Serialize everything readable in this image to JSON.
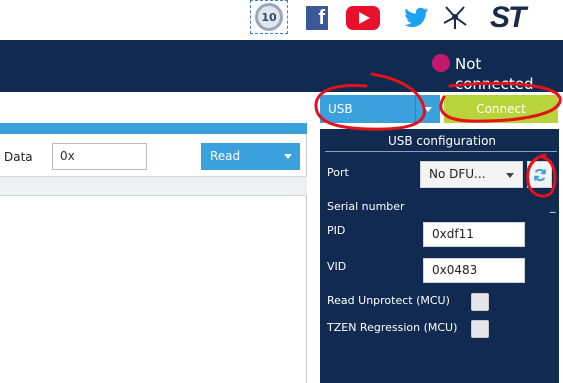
{
  "top_bar": {
    "icons": [
      "10-year-badge-icon",
      "facebook-icon",
      "youtube-icon",
      "twitter-icon",
      "network-icon",
      "st-logo-icon"
    ],
    "badge_text": "10",
    "facebook_glyph": "f",
    "twitter_glyph": "🐦",
    "logo_text": "ST"
  },
  "header": {
    "status_text": "Not connected",
    "status_color": "#c4186b",
    "band_color": "#102a52"
  },
  "main": {
    "data_label": "Data",
    "data_value": "0x",
    "read_label": "Read",
    "accent_color": "#3aa1dd"
  },
  "right_panel": {
    "interface_label": "USB",
    "connect_label": "Connect",
    "connect_color": "#b8d43a",
    "config_title": "USB configuration",
    "port_label": "Port",
    "port_value": "No DFU...",
    "serial_label": "Serial number",
    "serial_value": "_",
    "pid_label": "PID",
    "pid_value": "0xdf11",
    "vid_label": "VID",
    "vid_value": "0x0483",
    "read_unprotect_label": "Read Unprotect (MCU)",
    "tzen_label": "TZEN Regression (MCU)"
  },
  "annotations": {
    "color": "#e3121b",
    "shapes": [
      "circle-usb-dropdown",
      "circle-connect-button",
      "circle-refresh-button"
    ]
  }
}
